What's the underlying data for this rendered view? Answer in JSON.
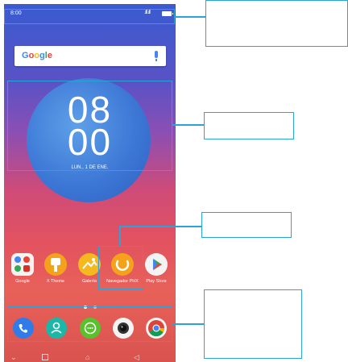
{
  "status_bar": {
    "time": "8:00",
    "signal": ".ıll .ıll"
  },
  "search": {
    "logo": "Google"
  },
  "clock": {
    "hours": "08",
    "minutes": "00",
    "date": "LUN., 1 DE ENE."
  },
  "apps": [
    {
      "label": "Google",
      "icon": "google-folder-icon"
    },
    {
      "label": "X Theme",
      "icon": "x-theme-icon"
    },
    {
      "label": "Galería",
      "icon": "gallery-icon"
    },
    {
      "label": "Navegador PHX",
      "icon": "phx-browser-icon"
    },
    {
      "label": "Play Store",
      "icon": "play-store-icon"
    }
  ],
  "dock": [
    {
      "icon": "phone-icon"
    },
    {
      "icon": "contacts-icon"
    },
    {
      "icon": "messages-icon"
    },
    {
      "icon": "camera-icon"
    },
    {
      "icon": "chrome-icon"
    }
  ],
  "colors": {
    "callout": "#2aa3d8",
    "phone_app": "#2f7be8",
    "contacts_app": "#19b8a8",
    "messages_app": "#59c12c",
    "xtheme_app": "#f4a21c",
    "gallery_app": "#f6b81f",
    "phx_app": "#f4a21c"
  }
}
